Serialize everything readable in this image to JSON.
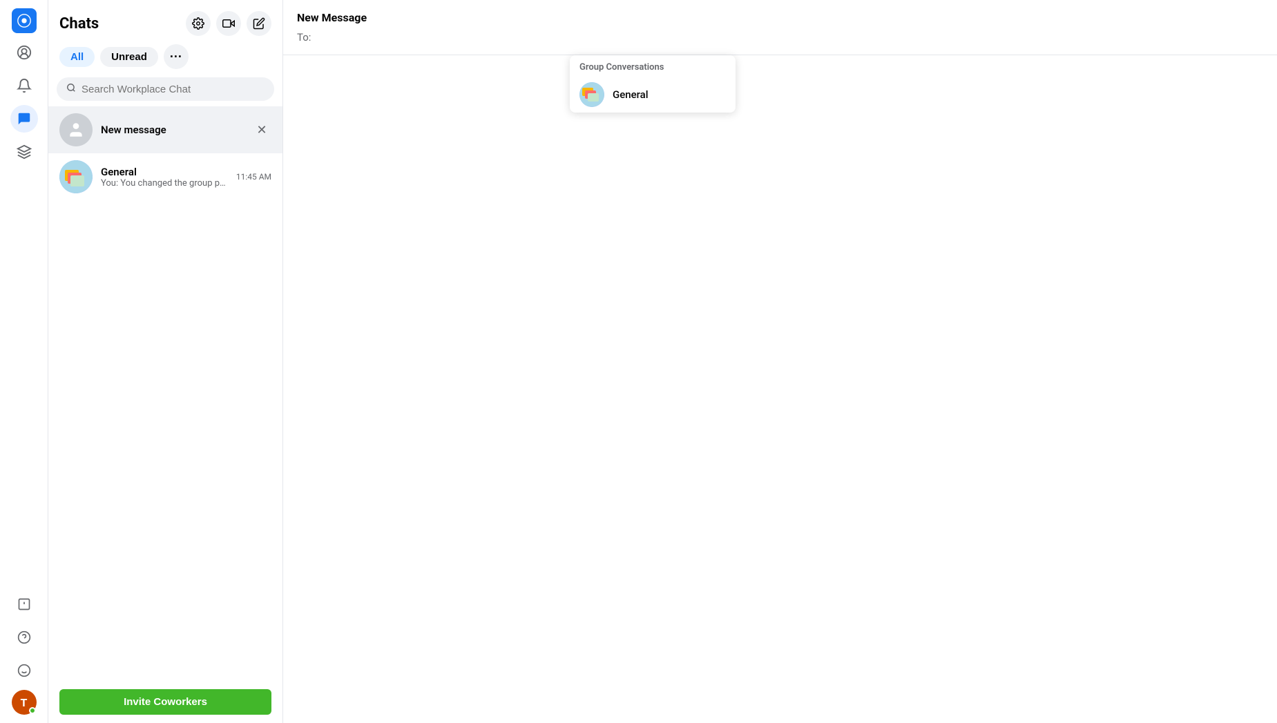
{
  "app": {
    "title": "Workplace Chat"
  },
  "sidebar": {
    "nav_items": [
      {
        "id": "home",
        "icon": "⌂",
        "label": "Home",
        "active": false
      },
      {
        "id": "notifications",
        "icon": "🔔",
        "label": "Notifications",
        "active": false
      },
      {
        "id": "chat",
        "icon": "💬",
        "label": "Chat",
        "active": true
      },
      {
        "id": "apps",
        "icon": "✺",
        "label": "Apps",
        "active": false
      }
    ],
    "bottom_items": [
      {
        "id": "feedback",
        "icon": "!",
        "label": "Feedback"
      },
      {
        "id": "help",
        "icon": "?",
        "label": "Help"
      },
      {
        "id": "emoji",
        "icon": "☺",
        "label": "Emoji"
      }
    ],
    "user": {
      "initials": "T",
      "label": "User Profile"
    }
  },
  "chats_panel": {
    "title": "Chats",
    "header_buttons": [
      {
        "id": "settings",
        "icon": "⚙",
        "label": "Settings"
      },
      {
        "id": "video",
        "icon": "▶",
        "label": "Video Call"
      },
      {
        "id": "compose",
        "icon": "✏",
        "label": "New Message"
      }
    ],
    "filter_tabs": [
      {
        "id": "all",
        "label": "All",
        "active": true
      },
      {
        "id": "unread",
        "label": "Unread",
        "active": false
      }
    ],
    "more_tab_label": "···",
    "search_placeholder": "Search Workplace Chat",
    "new_message_item": {
      "label": "New message",
      "close_icon": "✕"
    },
    "conversations": [
      {
        "id": "general",
        "name": "General",
        "preview": "You: You changed the group photo.",
        "time": "11:45 AM",
        "avatar_emoji": "🏢"
      }
    ],
    "invite_button_label": "Invite Coworkers"
  },
  "main_panel": {
    "header": {
      "title": "New Message",
      "to_label": "To:"
    },
    "dropdown": {
      "section_label": "Group Conversations",
      "items": [
        {
          "id": "general",
          "name": "General",
          "avatar_emoji": "🏢"
        }
      ]
    }
  }
}
